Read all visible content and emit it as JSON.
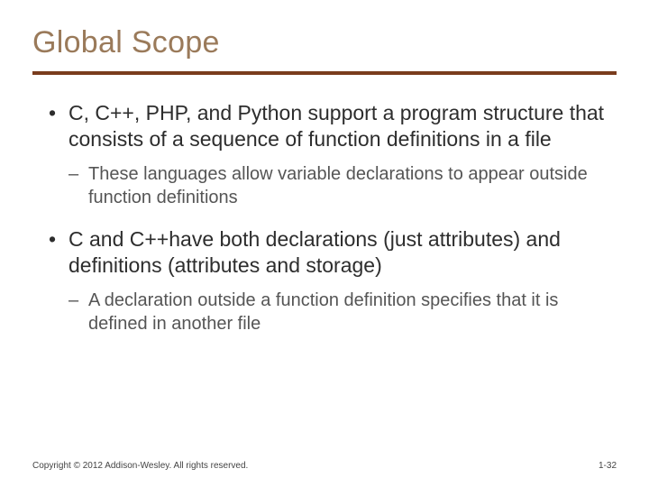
{
  "title": "Global Scope",
  "bullets": [
    {
      "text": "C, C++, PHP, and Python support a program structure that consists of a sequence of function definitions in a file",
      "sub": [
        "These languages allow variable declarations to appear outside function definitions"
      ]
    },
    {
      "text": "C and C++have both declarations (just attributes) and definitions (attributes and storage)",
      "sub": [
        "A declaration outside a function definition specifies that it is defined in another file"
      ]
    }
  ],
  "footer": {
    "copyright": "Copyright © 2012 Addison-Wesley. All rights reserved.",
    "page": "1-32"
  }
}
